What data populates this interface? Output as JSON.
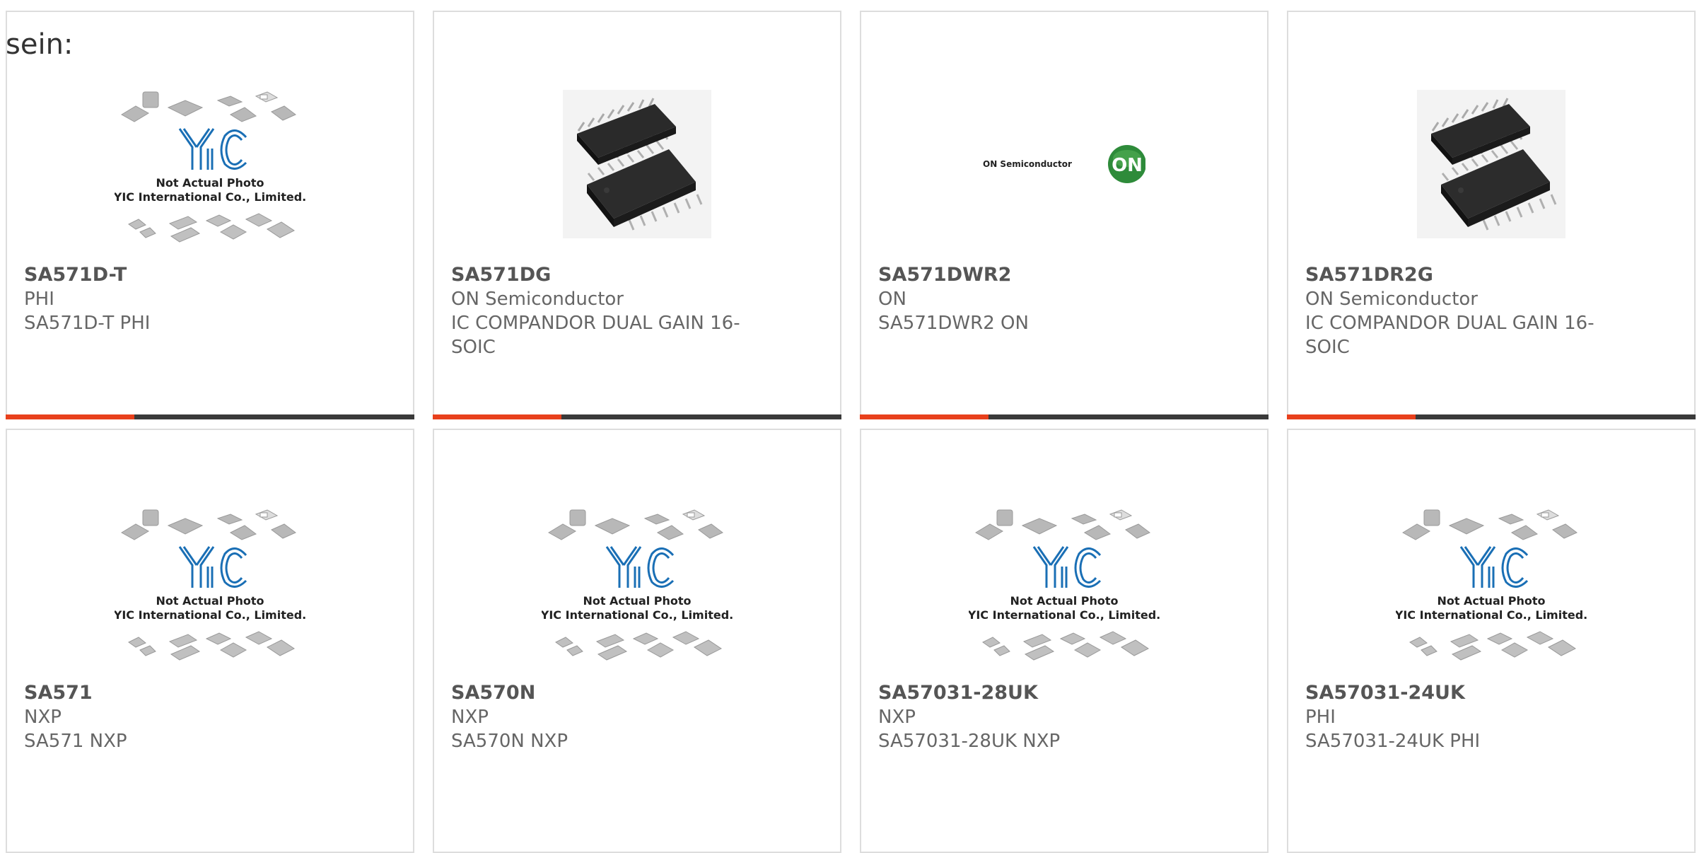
{
  "intro_text": "sein:",
  "placeholder_image": {
    "line1": "Not Actual Photo",
    "line2": "YIC International Co., Limited."
  },
  "colors": {
    "accent": "#e8401c",
    "bar": "#3a3a3a",
    "logo_blue": "#1a6fb5",
    "on_green": "#2e8b3a"
  },
  "products": [
    {
      "part": "SA571D-T",
      "manufacturer": "PHI",
      "description": "SA571D-T PHI",
      "image": "placeholder"
    },
    {
      "part": "SA571DG",
      "manufacturer": "ON Semiconductor",
      "description": "IC COMPANDOR DUAL GAIN 16-SOIC",
      "image": "soic-chip"
    },
    {
      "part": "SA571DWR2",
      "manufacturer": "ON",
      "description": "SA571DWR2 ON",
      "image": "on-logo",
      "on_logo_text": "ON Semiconductor",
      "on_badge": "ON"
    },
    {
      "part": "SA571DR2G",
      "manufacturer": "ON Semiconductor",
      "description": "IC COMPANDOR DUAL GAIN 16-SOIC",
      "image": "soic-chip"
    },
    {
      "part": "SA571",
      "manufacturer": "NXP",
      "description": "SA571 NXP",
      "image": "placeholder"
    },
    {
      "part": "SA570N",
      "manufacturer": "NXP",
      "description": "SA570N NXP",
      "image": "placeholder"
    },
    {
      "part": "SA57031-28UK",
      "manufacturer": "NXP",
      "description": "SA57031-28UK NXP",
      "image": "placeholder"
    },
    {
      "part": "SA57031-24UK",
      "manufacturer": "PHI",
      "description": "SA57031-24UK PHI",
      "image": "placeholder"
    }
  ]
}
